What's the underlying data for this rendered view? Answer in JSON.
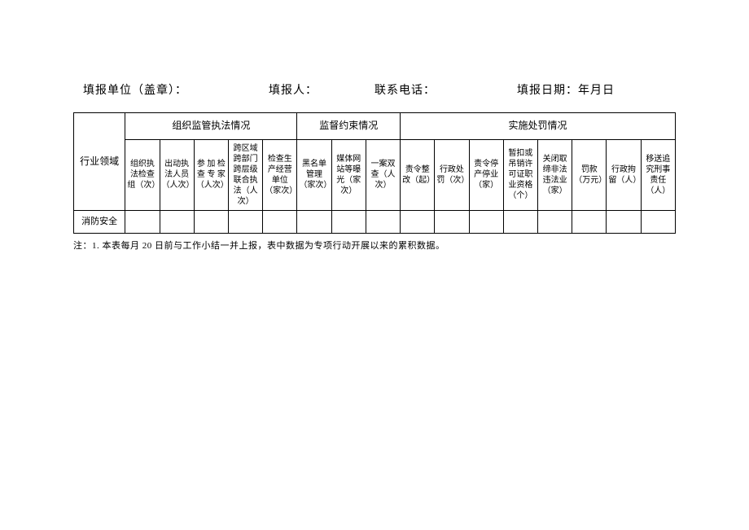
{
  "header": {
    "unit_label": "填报单位（盖章）：",
    "reporter_label": "填报人：",
    "phone_label": "联系电话：",
    "date_label": "填报日期：年月日"
  },
  "table": {
    "industry_header": "行业领域",
    "group1": "组织监管执法情况",
    "group2": "监督约束情况",
    "group3": "实施处罚情况",
    "cols": {
      "c1": "组织执法检查组（次）",
      "c2": "出动执法人员（人次）",
      "c3": "参 加 检查 专 家（人次）",
      "c4": "跨区域跨部门跨层级联合执法（人次）",
      "c5": "检查生产经营单位（家次）",
      "c6": "黑名单管理（家次）",
      "c7": "媒体网站等曝光（家次）",
      "c8": "一案双查（人次）",
      "c9": "责令整改（起）",
      "c10": "行政处罚（次）",
      "c11": "责令停产停业（家）",
      "c12": "暂扣或吊销许可证职业资格（个）",
      "c13": "关闭取缔非法违法业（家）",
      "c14": "罚款（万元）",
      "c15": "行政拘留（人）",
      "c16": "移送追究刑事责任（人）"
    },
    "rows": [
      {
        "category": "消防安全",
        "values": [
          "",
          "",
          "",
          "",
          "",
          "",
          "",
          "",
          "",
          "",
          "",
          "",
          "",
          "",
          "",
          ""
        ]
      }
    ]
  },
  "footnote": "注：1. 本表每月 20 日前与工作小结一并上报，表中数据为专项行动开展以来的累积数据。"
}
